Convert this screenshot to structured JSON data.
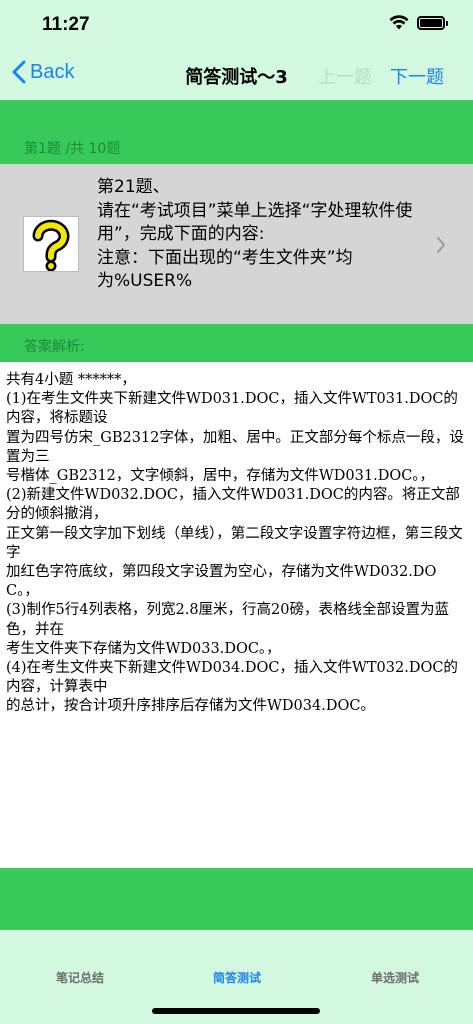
{
  "status_bar": {
    "time": "11:27"
  },
  "nav": {
    "back_label": "Back",
    "title": "简答测试～3",
    "prev_label": "上一题",
    "next_label": "下一题"
  },
  "question": {
    "progress": "第1题 /共 10题",
    "text": "第21题、\n请在“考试项目”菜单上选择“字处理软件使用”，完成下面的内容:\n注意：下面出现的“考生文件夹”均为%USER%"
  },
  "answer": {
    "label": "答案解析:",
    "text": "共有4小题 ******，\n(1)在考生文件夹下新建文件WD031.DOC，插入文件WT031.DOC的内容，将标题设\n置为四号仿宋_GB2312字体，加粗、居中。正文部分每个标点一段，设置为三\n号楷体_GB2312，文字倾斜，居中，存储为文件WD031.DOC。，\n(2)新建文件WD032.DOC，插入文件WD031.DOC的内容。将正文部分的倾斜撤消，\n正文第一段文字加下划线（单线），第二段文字设置字符边框，第三段文字\n加红色字符底纹，第四段文字设置为空心，存储为文件WD032.DOC。，\n(3)制作5行4列表格，列宽2.8厘米，行高20磅，表格线全部设置为蓝色，并在\n考生文件夹下存储为文件WD033.DOC。，\n(4)在考生文件夹下新建文件WD034.DOC，插入文件WT032.DOC的内容，计算表中\n的总计，按合计项升序排序后存储为文件WD034.DOC。"
  },
  "tabs": [
    {
      "label": "笔记总结"
    },
    {
      "label": "简答测试"
    },
    {
      "label": "单选测试"
    }
  ],
  "colors": {
    "header_bg": "#d2f8df",
    "band_green": "#37c95a",
    "accent_blue": "#1b82f6",
    "question_bg": "#d5d5d5"
  }
}
